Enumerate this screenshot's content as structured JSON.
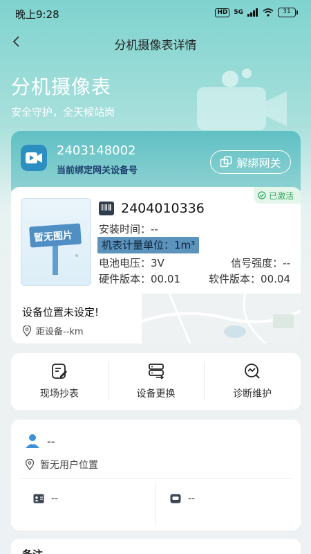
{
  "status_bar": {
    "time": "晚上9:28",
    "network": "5G",
    "hd": "HD",
    "battery": "31"
  },
  "nav": {
    "title": "分机摄像表详情",
    "back_icon": "chevron-left-icon"
  },
  "hero": {
    "title": "分机摄像表",
    "subtitle": "安全守护，全天候站岗"
  },
  "gateway": {
    "number": "2403148002",
    "label": "当前绑定网关设备号",
    "unbind_label": "解绑网关"
  },
  "device": {
    "image_placeholder": "暂无图片",
    "status": "已激活",
    "meter_id": "2404010336",
    "install_time": "安装时间：--",
    "unit": "机表计量单位：1m³",
    "battery_voltage": "电池电压：3V",
    "signal_strength": "信号强度：--",
    "hardware_version": "硬件版本：00.01",
    "software_version": "软件版本：00.04",
    "location_title": "设备位置未设定!",
    "distance": "距设备--km"
  },
  "actions": [
    {
      "label": "现场抄表",
      "icon": "edit-note-icon"
    },
    {
      "label": "设备更换",
      "icon": "server-swap-icon"
    },
    {
      "label": "诊断维护",
      "icon": "diagnose-chart-icon"
    }
  ],
  "user": {
    "name": "--",
    "location": "暂无用户位置",
    "id_card": "--",
    "device_field": "--"
  },
  "remark": {
    "label": "备注"
  },
  "colors": {
    "accent": "#5fc0c4",
    "activated": "#2aa55c",
    "unit_chip": "#5c93bd"
  }
}
